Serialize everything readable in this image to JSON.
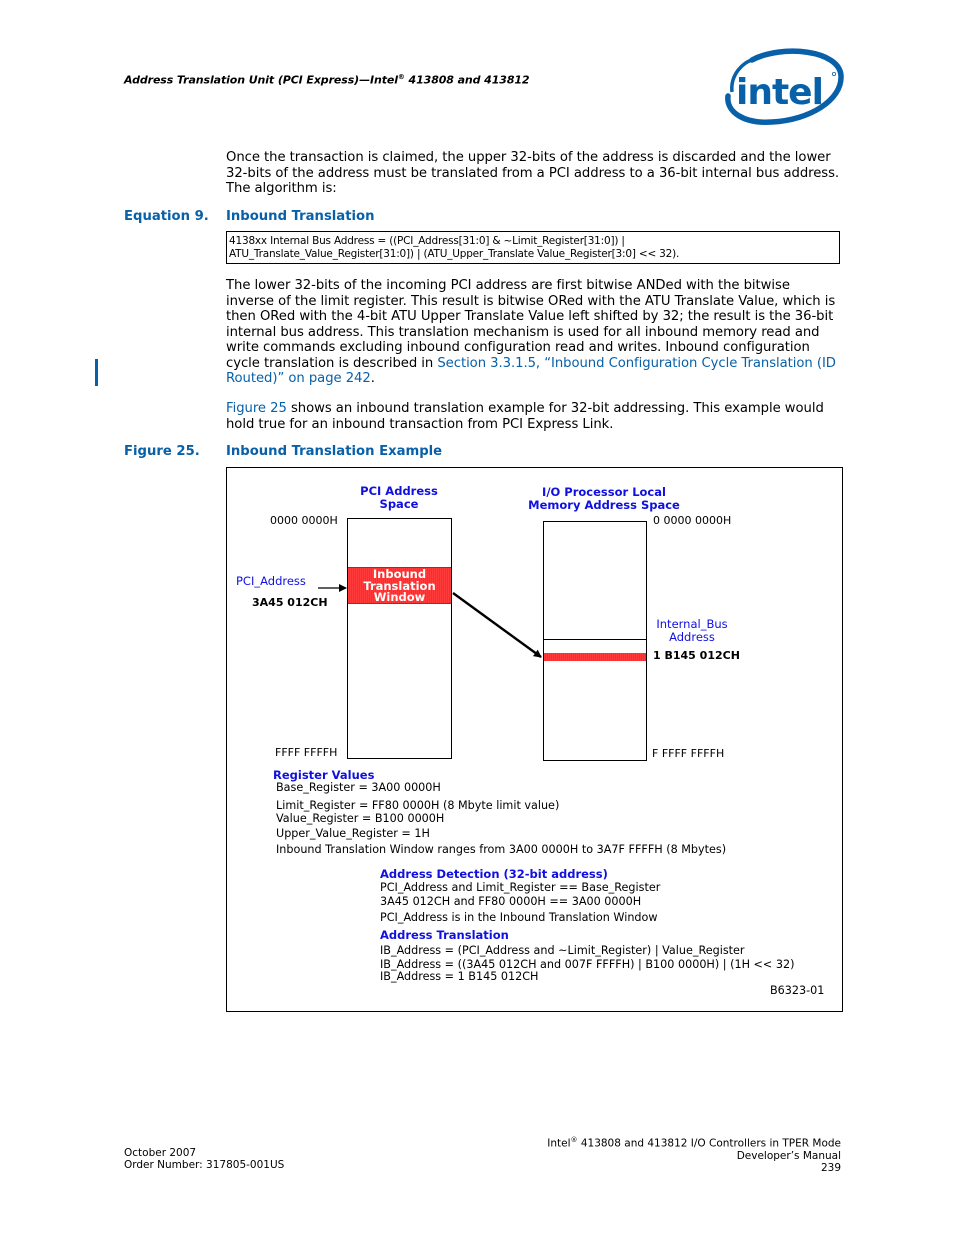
{
  "header": {
    "running_title_pre": "Address Translation Unit (PCI Express)—Intel",
    "registered_mark": "®",
    "running_title_post": " 413808 and 413812",
    "logo_text": "intel",
    "logo_colors": {
      "primary": "#0860a8"
    }
  },
  "intro_paragraph": "Once the transaction is claimed, the upper 32-bits of the address is discarded and the lower 32-bits of the address must be translated from a PCI address to a 36-bit internal bus address. The algorithm is:",
  "equation": {
    "number": "Equation 9.",
    "title": "Inbound Translation",
    "line1": "4138xx Internal Bus Address = ((PCI_Address[31:0] & ~Limit_Register[31:0]) |",
    "line2": "ATU_Translate_Value_Register[31:0]) | (ATU_Upper_Translate Value_Register[3:0] << 32)."
  },
  "explanation_paragraph": {
    "text": "The lower 32-bits of the incoming PCI address are first bitwise ANDed with the bitwise inverse of the limit register. This result is bitwise ORed with the ATU Translate Value, which is then ORed with the 4-bit ATU Upper Translate Value left shifted by 32; the result is the 36-bit internal bus address. This translation mechanism is used for all inbound memory read and write commands excluding inbound configuration read and writes. Inbound configuration cycle translation is described in ",
    "link_text": "Section 3.3.1.5, “Inbound Configuration Cycle Translation (ID Routed)” on page 242",
    "trailing": "."
  },
  "figure_ref_paragraph": {
    "link_text": "Figure 25",
    "text": " shows an inbound translation example for 32-bit addressing. This example would hold true for an inbound transaction from PCI Express Link."
  },
  "figure": {
    "number": "Figure 25.",
    "title": "Inbound Translation Example",
    "pci_space": {
      "title_line1": "PCI Address",
      "title_line2": "Space",
      "top_address": "0000 0000H",
      "bottom_address": "FFFF FFFFH",
      "window_line1": "Inbound",
      "window_line2": "Translation",
      "window_line3": "Window",
      "pointer_label": "PCI_Address",
      "pointer_value": "3A45 012CH"
    },
    "local_space": {
      "title_line1": "I/O Processor Local",
      "title_line2": "Memory Address Space",
      "top_address": "0 0000 0000H",
      "bottom_address": "F FFFF FFFFH",
      "pointer_label_line1": "Internal_Bus",
      "pointer_label_line2": "Address",
      "pointer_value": "1 B145 012CH"
    },
    "register_values": {
      "title": "Register Values",
      "lines": [
        "Base_Register = 3A00 0000H",
        "Limit_Register = FF80 0000H (8 Mbyte limit value)",
        "Value_Register = B100 0000H",
        "Upper_Value_Register = 1H",
        "Inbound Translation Window ranges from 3A00 0000H to 3A7F FFFFH (8 Mbytes)"
      ]
    },
    "address_detection": {
      "title": "Address Detection (32-bit address)",
      "lines": [
        "PCI_Address and Limit_Register == Base_Register",
        "3A45 012CH and FF80 0000H == 3A00 0000H",
        "PCI_Address is in the Inbound Translation Window"
      ]
    },
    "address_translation": {
      "title": "Address Translation",
      "lines": [
        "IB_Address = (PCI_Address and ~Limit_Register) | Value_Register",
        "IB_Address = ((3A45 012CH and 007F FFFFH) | B100 0000H) | (1H << 32)",
        "IB_Address = 1 B145 012CH"
      ]
    },
    "figure_id": "B6323-01"
  },
  "footer": {
    "date": "October 2007",
    "order_number": "Order Number: 317805-001US",
    "doc_title_pre": "Intel",
    "registered_mark": "®",
    "doc_title_post": " 413808 and 413812 I/O Controllers in TPER Mode",
    "doc_subtitle": "Developer’s Manual",
    "page_number": "239"
  }
}
